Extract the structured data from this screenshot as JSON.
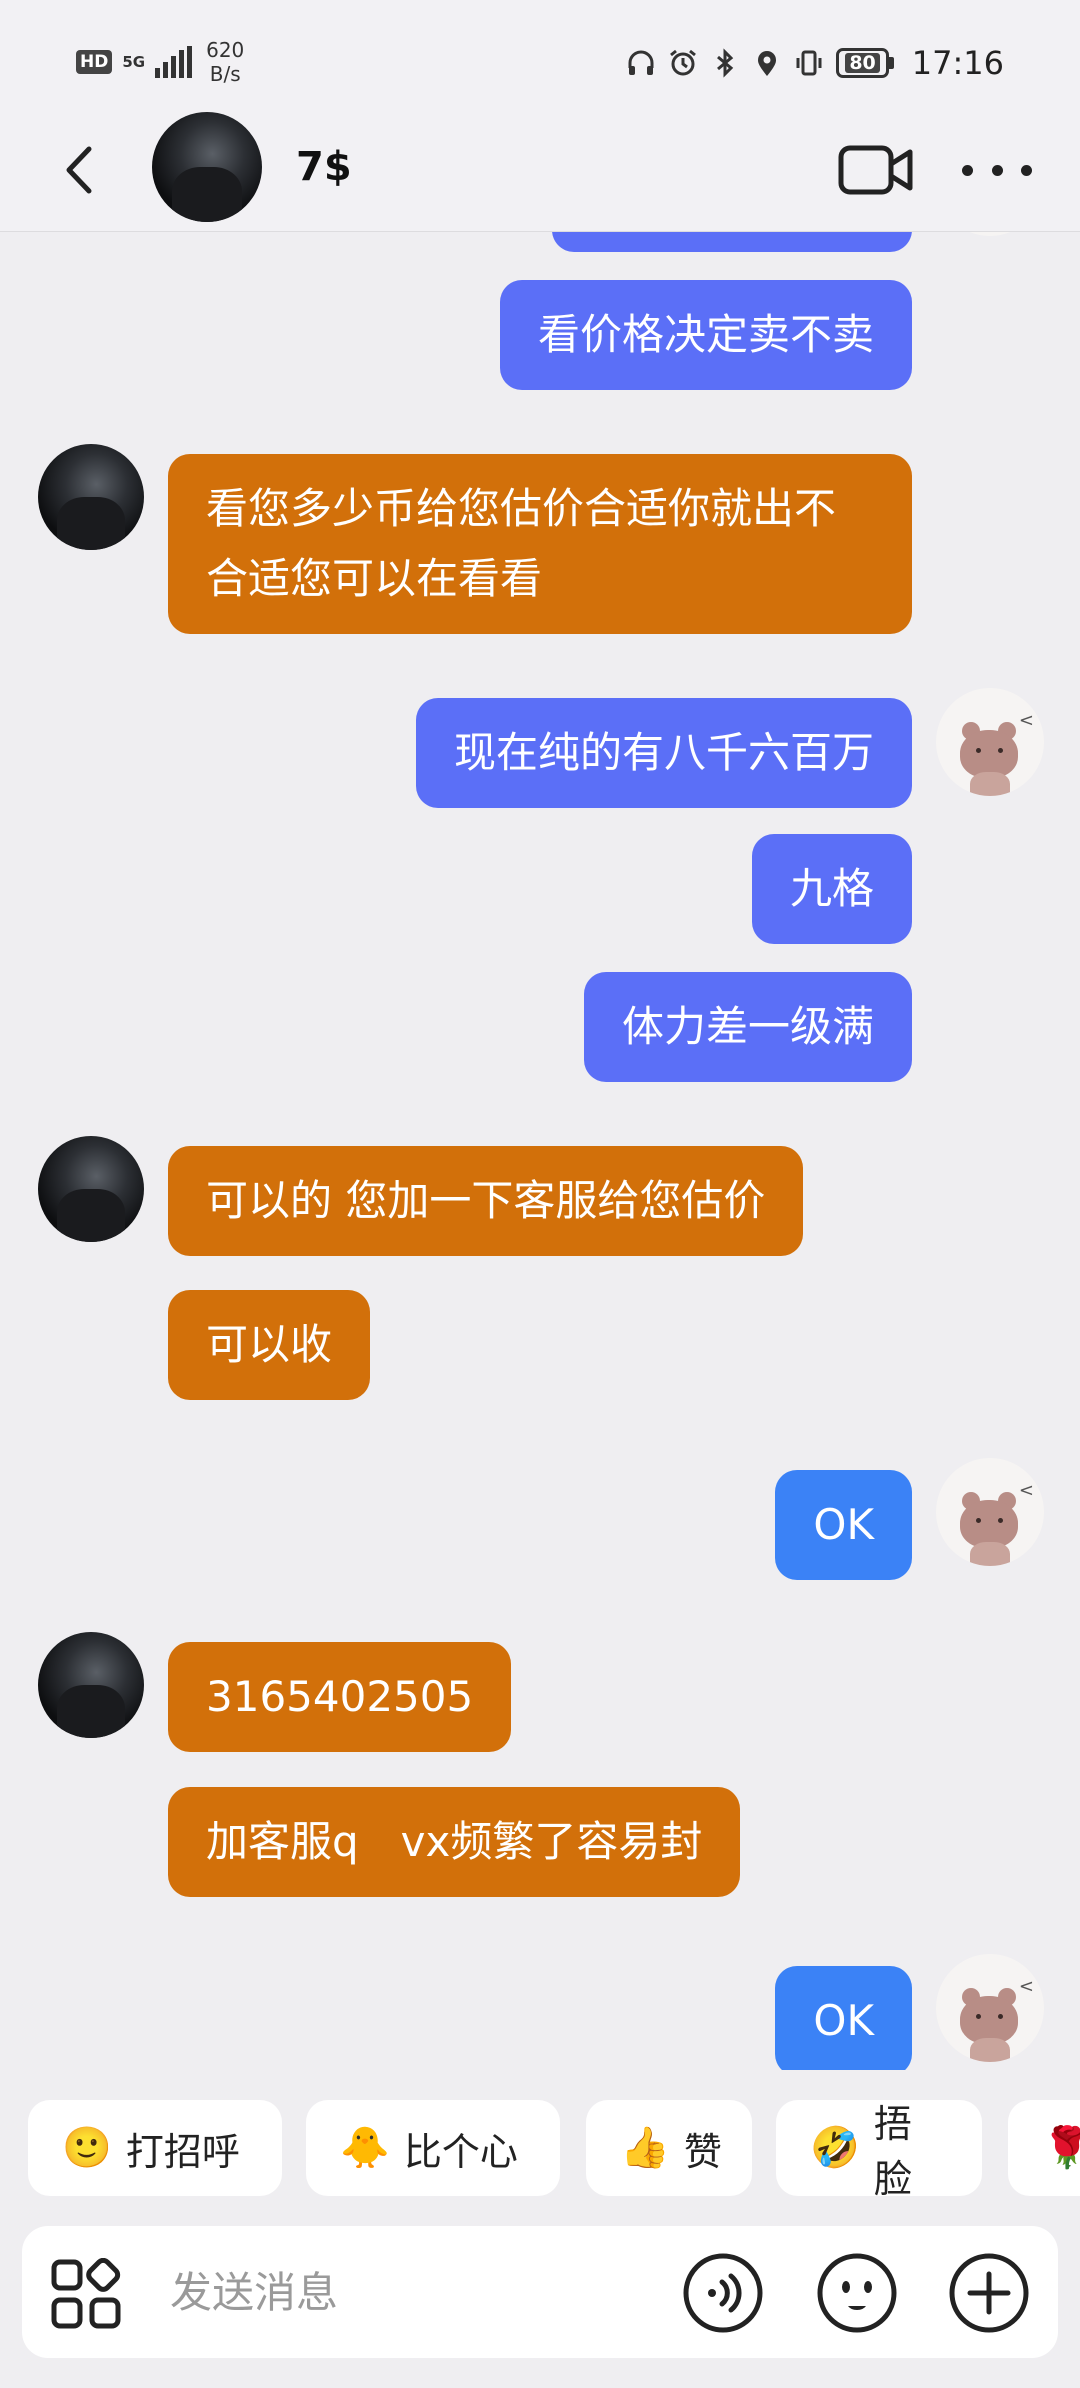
{
  "status_bar": {
    "hd": "HD",
    "signal": "5G",
    "net_speed_value": "620",
    "net_speed_unit": "B/s",
    "battery": "80",
    "time": "17:16"
  },
  "header": {
    "contact_name": "7$"
  },
  "messages": [
    {
      "side": "right",
      "style": "purple",
      "text": "看价格决定卖不卖"
    },
    {
      "side": "left",
      "style": "orange",
      "text": "看您多少币给您估价合适你就出不合适您可以在看看"
    },
    {
      "side": "right",
      "style": "purple",
      "text": "现在纯的有八千六百万"
    },
    {
      "side": "right",
      "style": "purple",
      "text": "九格"
    },
    {
      "side": "right",
      "style": "purple",
      "text": "体力差一级满"
    },
    {
      "side": "left",
      "style": "orange",
      "text": "可以的 您加一下客服给您估价"
    },
    {
      "side": "left",
      "style": "orange",
      "text": "可以收"
    },
    {
      "side": "right",
      "style": "blue",
      "text": "OK"
    },
    {
      "side": "left",
      "style": "orange",
      "text": "3165402505"
    },
    {
      "side": "left",
      "style": "orange",
      "text": "加客服q　vx频繁了容易封"
    },
    {
      "side": "right",
      "style": "blue",
      "text": "OK"
    }
  ],
  "quick_replies": [
    {
      "emoji": "🙂",
      "label": "打招呼"
    },
    {
      "emoji": "🐥",
      "label": "比个心"
    },
    {
      "emoji": "👍",
      "label": "赞"
    },
    {
      "emoji": "🤣",
      "label": "捂脸"
    },
    {
      "emoji": "🌹",
      "label": ""
    }
  ],
  "input": {
    "placeholder": "发送消息",
    "value": ""
  },
  "colors": {
    "outgoing_purple": "#5b6ff7",
    "outgoing_blue": "#3b82f6",
    "incoming_orange": "#d2700a",
    "background": "#efeef1"
  },
  "icons": [
    "back-arrow-icon",
    "video-call-icon",
    "more-icon",
    "apps-icon",
    "voice-icon",
    "emoji-icon",
    "plus-icon"
  ]
}
